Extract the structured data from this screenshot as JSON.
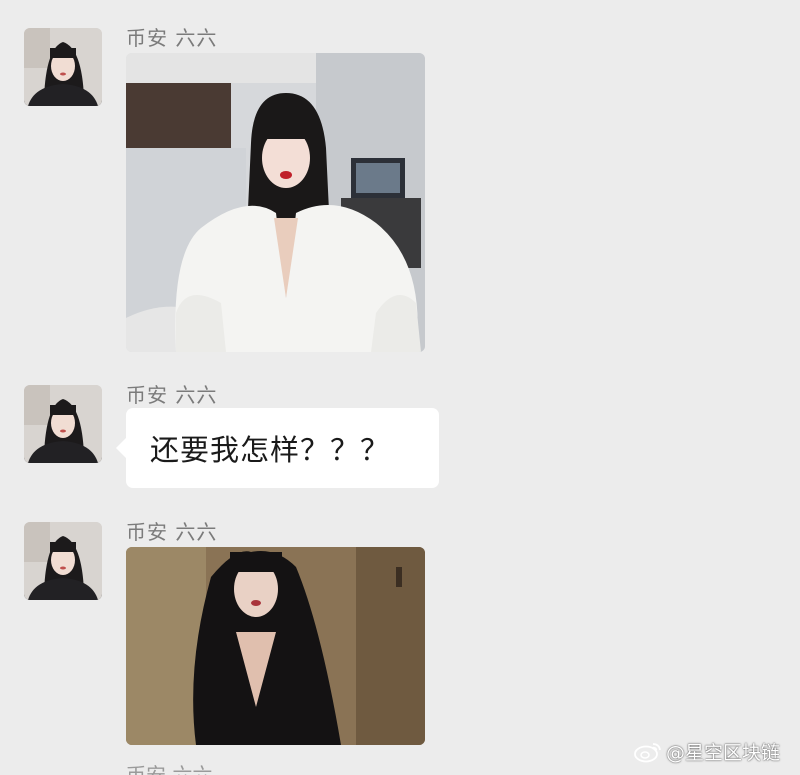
{
  "colors": {
    "chat_background": "#ececec",
    "bubble_background": "#ffffff",
    "name_text": "#7b7b7b",
    "message_text": "#1a1a1a"
  },
  "messages": [
    {
      "type": "image",
      "sender": "币安 六六",
      "avatar_icon": "profile-photo",
      "image_icon": "photo-woman-white-robe"
    },
    {
      "type": "text",
      "sender": "币安 六六",
      "avatar_icon": "profile-photo",
      "text": "还要我怎样？？？"
    },
    {
      "type": "image",
      "sender": "币安 六六",
      "avatar_icon": "profile-photo",
      "image_icon": "photo-woman-black-top"
    }
  ],
  "watermark": {
    "icon": "weibo-icon",
    "text": "@星空区块链"
  }
}
